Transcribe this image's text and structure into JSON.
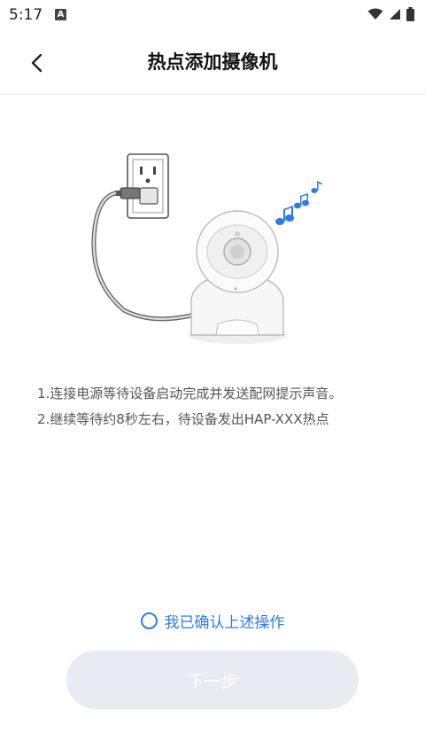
{
  "status_bar": {
    "time": "5:17",
    "notification_icon_letter": "A",
    "icons": [
      "wifi-icon",
      "signal-icon",
      "battery-icon"
    ]
  },
  "header": {
    "title": "热点添加摄像机",
    "back_icon": "chevron-left-icon"
  },
  "illustration": {
    "description_icons": [
      "power-outlet-icon",
      "camera-icon",
      "music-notes-icon"
    ],
    "accent_color": "#2e7be6"
  },
  "instructions": [
    "1.连接电源等待设备启动完成并发送配网提示声音。",
    "2.继续等待约8秒左右，待设备发出HAP-XXX热点"
  ],
  "confirm": {
    "label": "我已确认上述操作",
    "checked": false,
    "color": "#2e7be6"
  },
  "next_button": {
    "label": "下一步",
    "enabled": false,
    "background": "#e9ebf2"
  }
}
